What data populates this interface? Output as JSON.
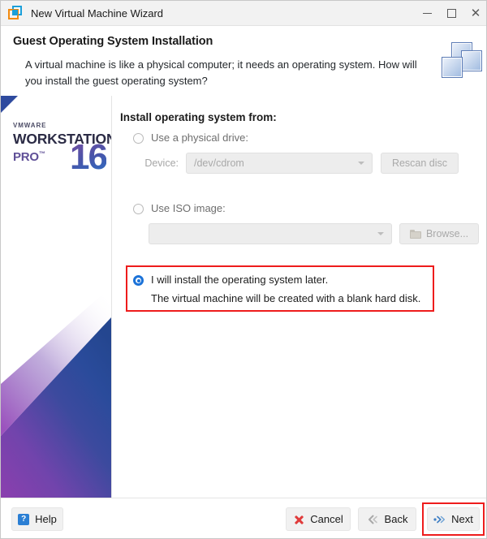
{
  "window": {
    "title": "New Virtual Machine Wizard",
    "icon": "vmware-logo-icon",
    "controls": {
      "minimize": "minimize-icon",
      "maximize": "maximize-icon",
      "close": "close-icon"
    }
  },
  "header": {
    "title": "Guest Operating System Installation",
    "description": "A virtual machine is like a physical computer; it needs an operating system. How will you install the guest operating system?",
    "logo": "three-stacked-squares-icon"
  },
  "sidebar": {
    "vendor": "VMWARE",
    "product": "WORKSTATION",
    "edition": "PRO",
    "trademark": "™",
    "version": "16"
  },
  "main": {
    "section_title": "Install operating system from:",
    "options": [
      {
        "id": "physical-drive",
        "label": "Use a physical drive:",
        "selected": false,
        "enabled": false,
        "device_label": "Device:",
        "device_value": "/dev/cdrom",
        "rescan_label": "Rescan disc"
      },
      {
        "id": "iso-image",
        "label": "Use ISO image:",
        "selected": false,
        "enabled": false,
        "iso_value": "",
        "browse_label": "Browse...",
        "browse_icon": "folder-icon"
      },
      {
        "id": "install-later",
        "label": "I will install the operating system later.",
        "note": "The virtual machine will be created with a blank hard disk.",
        "selected": true,
        "enabled": true,
        "highlighted": true
      }
    ]
  },
  "footer": {
    "help": {
      "label": "Help",
      "icon": "question-mark-icon"
    },
    "cancel": {
      "label": "Cancel",
      "icon": "red-x-icon"
    },
    "back": {
      "label": "Back",
      "icon": "left-double-chevron-icon"
    },
    "next": {
      "label": "Next",
      "icon": "right-double-chevron-icon",
      "highlighted": true
    }
  },
  "colors": {
    "accent_blue": "#1b72d8",
    "annotation_red": "#ee1c1c",
    "brand_purple": "#5f4f97",
    "brand_blue": "#2e4a9e"
  }
}
